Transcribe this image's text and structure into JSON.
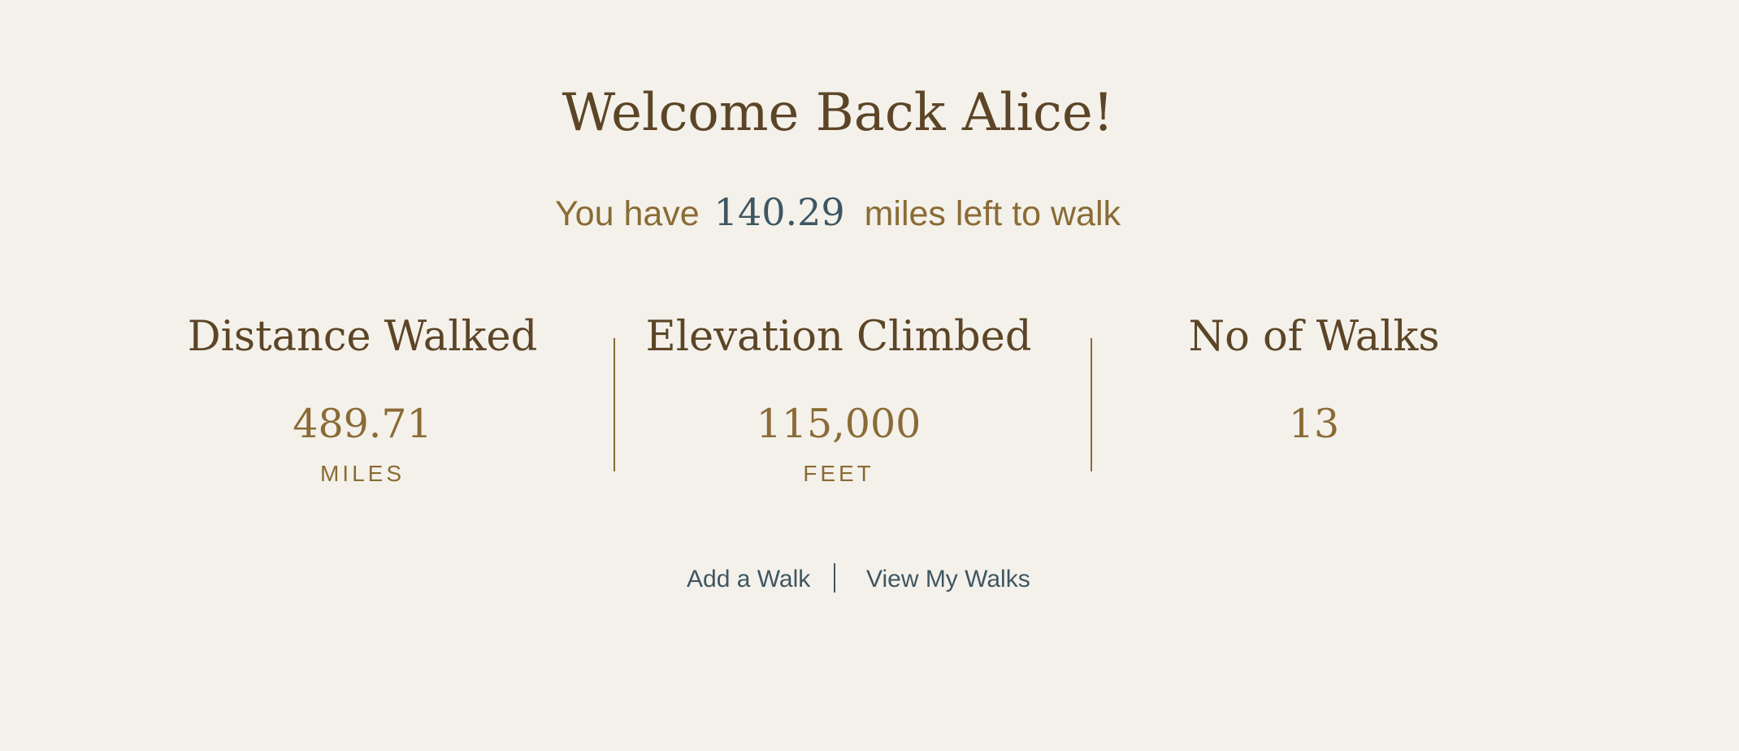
{
  "header": {
    "welcome": "Welcome Back Alice!",
    "remaining_prefix": "You have",
    "remaining_miles": "140.29",
    "remaining_suffix": "miles left to walk"
  },
  "stats": [
    {
      "label": "Distance Walked",
      "value": "489.71",
      "unit": "MILES"
    },
    {
      "label": "Elevation Climbed",
      "value": "115,000",
      "unit": "FEET"
    },
    {
      "label": "No of Walks",
      "value": "13",
      "unit": ""
    }
  ],
  "actions": {
    "add_walk": "Add a Walk",
    "view_walks": "View My Walks"
  },
  "colors": {
    "background": "#f4f1eb",
    "heading": "#5c4526",
    "accent": "#8a6b35",
    "link": "#3e5661"
  }
}
